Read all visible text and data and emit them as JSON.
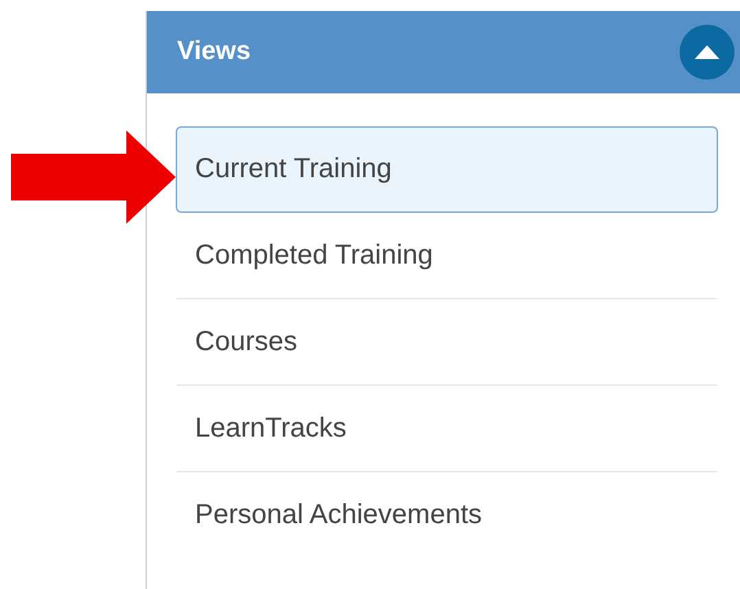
{
  "panel": {
    "title": "Views",
    "expanded": true
  },
  "views": [
    {
      "label": "Current Training",
      "selected": true
    },
    {
      "label": "Completed Training",
      "selected": false
    },
    {
      "label": "Courses",
      "selected": false
    },
    {
      "label": "LearnTracks",
      "selected": false
    },
    {
      "label": "Personal Achievements",
      "selected": false
    }
  ]
}
